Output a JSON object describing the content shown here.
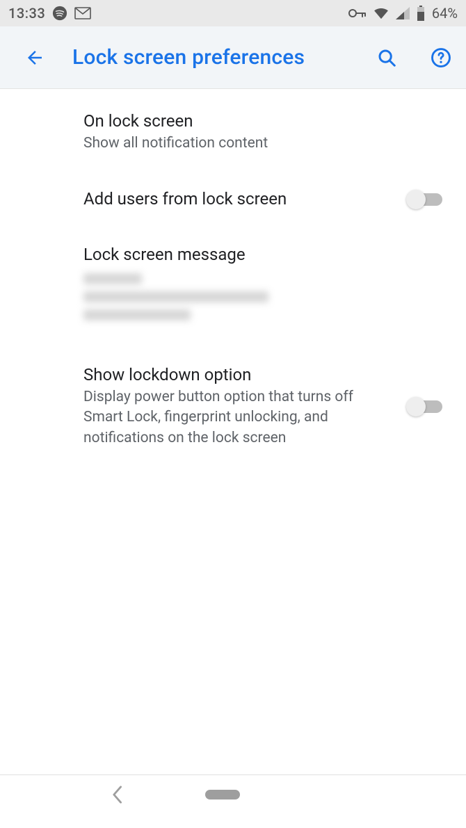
{
  "statusbar": {
    "time": "13:33",
    "battery_text": "64%"
  },
  "appbar": {
    "title": "Lock screen preferences"
  },
  "prefs": {
    "on_lock_screen": {
      "title": "On lock screen",
      "summary": "Show all notification content"
    },
    "add_users": {
      "title": "Add users from lock screen",
      "checked": false
    },
    "lock_screen_message": {
      "title": "Lock screen message"
    },
    "show_lockdown": {
      "title": "Show lockdown option",
      "summary": "Display power button option that turns off Smart Lock, fingerprint unlocking, and notifications on the lock screen",
      "checked": false
    }
  }
}
